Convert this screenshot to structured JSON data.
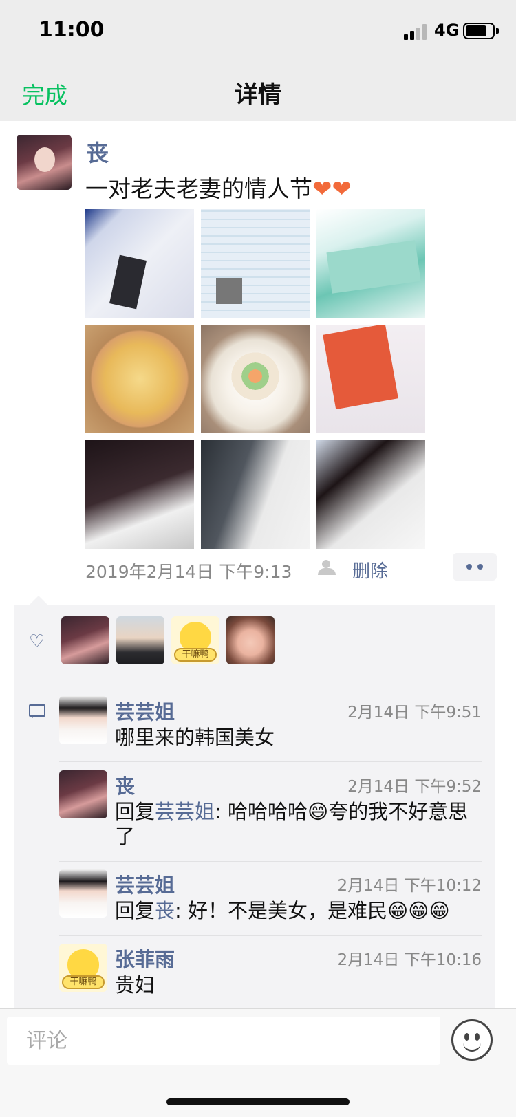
{
  "status_bar": {
    "time": "11:00",
    "network": "4G"
  },
  "nav": {
    "done_label": "完成",
    "title": "详情"
  },
  "post": {
    "author": "丧",
    "text": "一对老夫老妻的情人节",
    "text_emoji": "❤❤",
    "timestamp": "2019年2月14日 下午9:13",
    "delete_label": "删除"
  },
  "likes": {
    "heart_icon": "heart-outline-icon"
  },
  "comments": [
    {
      "name": "芸芸姐",
      "time": "2月14日 下午9:51",
      "text": "哪里来的韩国美女"
    },
    {
      "name": "丧",
      "time": "2月14日 下午9:52",
      "reply_prefix": "回复",
      "reply_to": "芸芸姐",
      "text": ": 哈哈哈哈😄夸的我不好意思了"
    },
    {
      "name": "芸芸姐",
      "time": "2月14日 下午10:12",
      "reply_prefix": "回复",
      "reply_to": "丧",
      "text": ": 好！不是美女，是难民😁😁😁"
    },
    {
      "name": "张菲雨",
      "time": "2月14日 下午10:16",
      "text": "贵妇"
    }
  ],
  "sticker_text": "干嘛鸭",
  "input": {
    "placeholder": "评论",
    "value": ""
  },
  "colors": {
    "accent_green": "#07c160",
    "link_blue": "#576b95",
    "panel_bg": "#f3f3f5"
  }
}
